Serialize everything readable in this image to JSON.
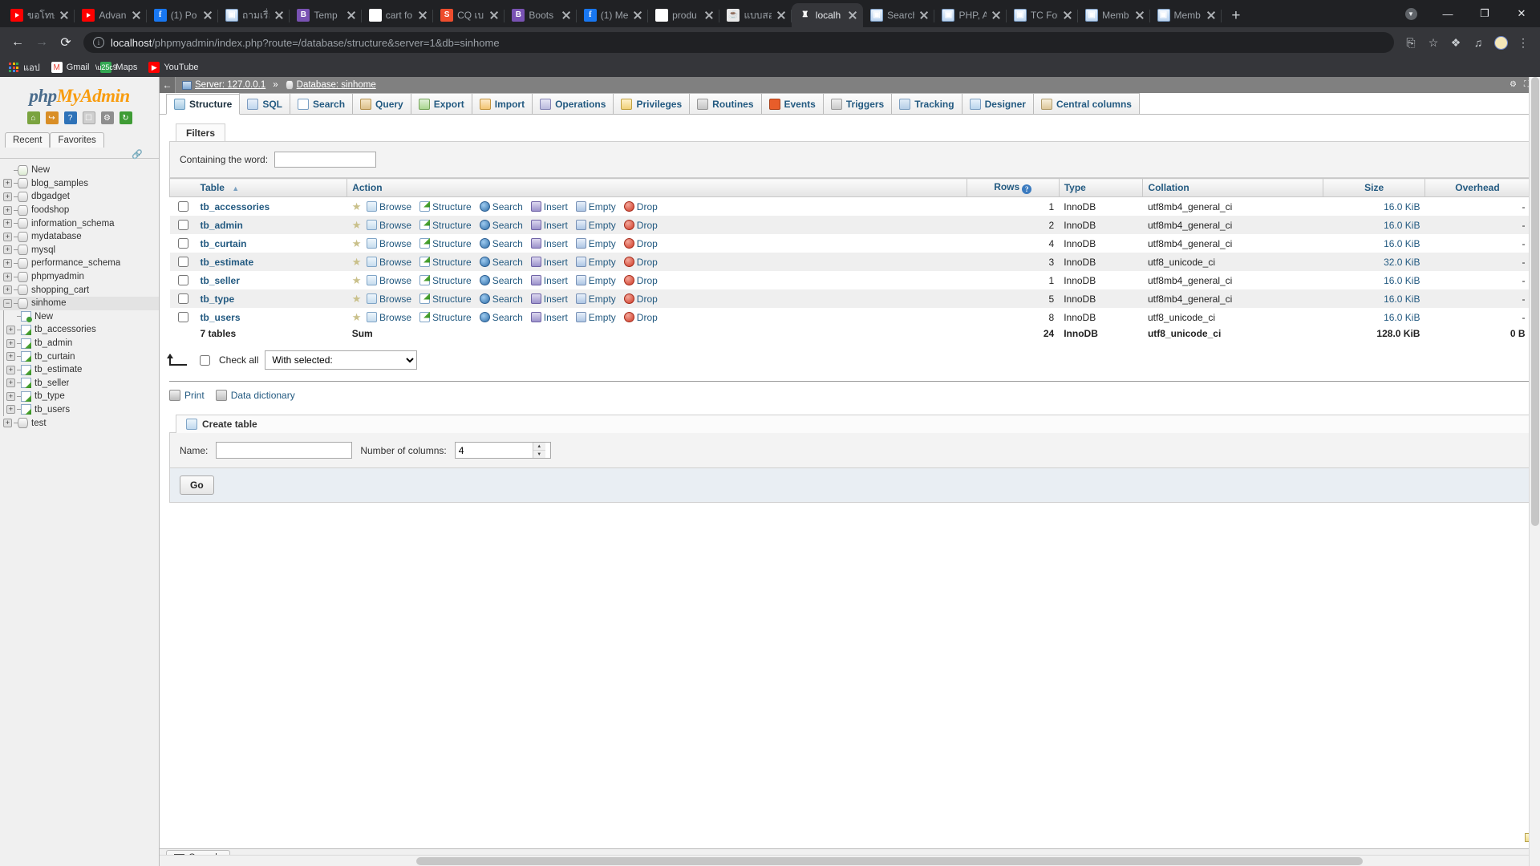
{
  "browser": {
    "tabs": [
      {
        "label": "ขอโทษ",
        "icon": "youtube-icon",
        "icon_class": "fv-yt",
        "glyph": "",
        "active": false
      },
      {
        "label": "Advan",
        "icon": "youtube-icon",
        "icon_class": "fv-yt",
        "glyph": "",
        "active": false
      },
      {
        "label": "(1) Po",
        "icon": "facebook-icon",
        "icon_class": "fv-fb",
        "glyph": "f",
        "active": false
      },
      {
        "label": "ถามเรื่อ",
        "icon": "windows-page-icon",
        "icon_class": "fv-ie",
        "glyph": "▣",
        "active": false
      },
      {
        "label": "Temp",
        "icon": "bootstrap-icon",
        "icon_class": "fv-b",
        "glyph": "B",
        "active": false
      },
      {
        "label": "cart fo",
        "icon": "google-icon",
        "icon_class": "fv-g",
        "glyph": "G",
        "active": false
      },
      {
        "label": "CQ เบ",
        "icon": "shopee-icon",
        "icon_class": "fv-s",
        "glyph": "S",
        "active": false
      },
      {
        "label": "Boots",
        "icon": "bootstrap-icon",
        "icon_class": "fv-b",
        "glyph": "B",
        "active": false
      },
      {
        "label": "(1) Me",
        "icon": "facebook-icon",
        "icon_class": "fv-fb",
        "glyph": "f",
        "active": false
      },
      {
        "label": "produ",
        "icon": "google-icon",
        "icon_class": "fv-g",
        "glyph": "G",
        "active": false
      },
      {
        "label": "แบบสอ",
        "icon": "java-icon",
        "icon_class": "fv-java",
        "glyph": "☕",
        "active": false
      },
      {
        "label": "localh",
        "icon": "phpmyadmin-icon",
        "icon_class": "fv-pma",
        "glyph": "♜",
        "active": true
      },
      {
        "label": "Search",
        "icon": "windows-page-icon",
        "icon_class": "fv-ie",
        "glyph": "▣",
        "active": false
      },
      {
        "label": "PHP, A",
        "icon": "windows-page-icon",
        "icon_class": "fv-ie",
        "glyph": "▣",
        "active": false
      },
      {
        "label": "TC For",
        "icon": "windows-page-icon",
        "icon_class": "fv-ie",
        "glyph": "▣",
        "active": false
      },
      {
        "label": "Memb",
        "icon": "windows-page-icon",
        "icon_class": "fv-ie",
        "glyph": "▣",
        "active": false
      },
      {
        "label": "Memb",
        "icon": "windows-page-icon",
        "icon_class": "fv-ie",
        "glyph": "▣",
        "active": false
      }
    ],
    "new_tab_label": "+",
    "window_controls": {
      "minimize": "—",
      "maximize": "❐",
      "close": "✕",
      "chevron": "▼"
    },
    "nav": {
      "back": "←",
      "forward": "→",
      "reload": "⟳"
    },
    "omnibox": {
      "host": "localhost",
      "path": "/phpmyadmin/index.php?route=/database/structure&server=1&db=sinhome",
      "info_glyph": "i"
    },
    "toolbar_icons": {
      "translate": "⎘",
      "star": "☆",
      "extensions": "❖",
      "media": "♫",
      "menu": "⋮"
    },
    "bookmarks": [
      {
        "label": "แอป",
        "icon": "apps-grid-icon"
      },
      {
        "label": "Gmail",
        "icon": "gmail-icon"
      },
      {
        "label": "Maps",
        "icon": "maps-icon"
      },
      {
        "label": "YouTube",
        "icon": "youtube-icon"
      }
    ]
  },
  "sidebar": {
    "logo": {
      "part1": "php",
      "part2": "MyAdmin"
    },
    "icons": [
      {
        "name": "home-icon",
        "glyph": "⌂"
      },
      {
        "name": "logout-icon",
        "glyph": "↪"
      },
      {
        "name": "help-docs-icon",
        "glyph": "?"
      },
      {
        "name": "documentation-icon",
        "glyph": "❐"
      },
      {
        "name": "settings-gear-icon",
        "glyph": "⚙"
      },
      {
        "name": "reload-navigation-icon",
        "glyph": "⟳"
      }
    ],
    "recent_label": "Recent",
    "favorites_label": "Favorites",
    "tree": [
      {
        "label": "New",
        "type": "new",
        "depth": 0,
        "expander": null
      },
      {
        "label": "blog_samples",
        "type": "db",
        "depth": 0,
        "expander": "+"
      },
      {
        "label": "dbgadget",
        "type": "db",
        "depth": 0,
        "expander": "+"
      },
      {
        "label": "foodshop",
        "type": "db",
        "depth": 0,
        "expander": "+"
      },
      {
        "label": "information_schema",
        "type": "db",
        "depth": 0,
        "expander": "+"
      },
      {
        "label": "mydatabase",
        "type": "db",
        "depth": 0,
        "expander": "+"
      },
      {
        "label": "mysql",
        "type": "db",
        "depth": 0,
        "expander": "+"
      },
      {
        "label": "performance_schema",
        "type": "db",
        "depth": 0,
        "expander": "+"
      },
      {
        "label": "phpmyadmin",
        "type": "db",
        "depth": 0,
        "expander": "+"
      },
      {
        "label": "shopping_cart",
        "type": "db",
        "depth": 0,
        "expander": "+"
      },
      {
        "label": "sinhome",
        "type": "db",
        "depth": 0,
        "expander": "−",
        "selected": true
      },
      {
        "label": "New",
        "type": "newtable",
        "depth": 1,
        "expander": null
      },
      {
        "label": "tb_accessories",
        "type": "table",
        "depth": 1,
        "expander": "+"
      },
      {
        "label": "tb_admin",
        "type": "table",
        "depth": 1,
        "expander": "+"
      },
      {
        "label": "tb_curtain",
        "type": "table",
        "depth": 1,
        "expander": "+"
      },
      {
        "label": "tb_estimate",
        "type": "table",
        "depth": 1,
        "expander": "+"
      },
      {
        "label": "tb_seller",
        "type": "table",
        "depth": 1,
        "expander": "+"
      },
      {
        "label": "tb_type",
        "type": "table",
        "depth": 1,
        "expander": "+"
      },
      {
        "label": "tb_users",
        "type": "table",
        "depth": 1,
        "expander": "+"
      },
      {
        "label": "test",
        "type": "db",
        "depth": 0,
        "expander": "+"
      }
    ]
  },
  "breadcrumb": {
    "back_glyph": "←",
    "server_label": "Server: 127.0.0.1",
    "separator": "»",
    "database_label": "Database: sinhome"
  },
  "main_tabs": [
    {
      "label": "Structure",
      "icon": "structure-icon",
      "icon_class": "pic-struct",
      "active": true
    },
    {
      "label": "SQL",
      "icon": "sql-icon",
      "icon_class": "pic-sql",
      "active": false
    },
    {
      "label": "Search",
      "icon": "search-icon",
      "icon_class": "pic-search",
      "active": false
    },
    {
      "label": "Query",
      "icon": "query-icon",
      "icon_class": "pic-query",
      "active": false
    },
    {
      "label": "Export",
      "icon": "export-icon",
      "icon_class": "pic-export",
      "active": false
    },
    {
      "label": "Import",
      "icon": "import-icon",
      "icon_class": "pic-import",
      "active": false
    },
    {
      "label": "Operations",
      "icon": "operations-icon",
      "icon_class": "pic-ops",
      "active": false
    },
    {
      "label": "Privileges",
      "icon": "privileges-icon",
      "icon_class": "pic-priv",
      "active": false
    },
    {
      "label": "Routines",
      "icon": "routines-icon",
      "icon_class": "pic-rout",
      "active": false
    },
    {
      "label": "Events",
      "icon": "events-icon",
      "icon_class": "pic-ev",
      "active": false
    },
    {
      "label": "Triggers",
      "icon": "triggers-icon",
      "icon_class": "pic-trig",
      "active": false
    },
    {
      "label": "Tracking",
      "icon": "tracking-icon",
      "icon_class": "pic-track",
      "active": false
    },
    {
      "label": "Designer",
      "icon": "designer-icon",
      "icon_class": "pic-design",
      "active": false
    },
    {
      "label": "Central columns",
      "icon": "central-columns-icon",
      "icon_class": "pic-central",
      "active": false
    }
  ],
  "filters": {
    "legend": "Filters",
    "containing_label": "Containing the word:",
    "containing_value": "",
    "containing_placeholder": ""
  },
  "table_list": {
    "columns": [
      "Table",
      "Action",
      "Rows",
      "Type",
      "Collation",
      "Size",
      "Overhead"
    ],
    "sort_indicator": "▲",
    "rows_help_glyph": "?",
    "actions": [
      "Browse",
      "Structure",
      "Search",
      "Insert",
      "Empty",
      "Drop"
    ],
    "action_icons": [
      "ai-browse",
      "ai-struct",
      "ai-search",
      "ai-insert",
      "ai-empty",
      "ai-drop"
    ],
    "rows": [
      {
        "name": "tb_accessories",
        "rows": "1",
        "type": "InnoDB",
        "collation": "utf8mb4_general_ci",
        "size": "16.0 KiB",
        "overhead": "-"
      },
      {
        "name": "tb_admin",
        "rows": "2",
        "type": "InnoDB",
        "collation": "utf8mb4_general_ci",
        "size": "16.0 KiB",
        "overhead": "-"
      },
      {
        "name": "tb_curtain",
        "rows": "4",
        "type": "InnoDB",
        "collation": "utf8mb4_general_ci",
        "size": "16.0 KiB",
        "overhead": "-"
      },
      {
        "name": "tb_estimate",
        "rows": "3",
        "type": "InnoDB",
        "collation": "utf8_unicode_ci",
        "size": "32.0 KiB",
        "overhead": "-"
      },
      {
        "name": "tb_seller",
        "rows": "1",
        "type": "InnoDB",
        "collation": "utf8mb4_general_ci",
        "size": "16.0 KiB",
        "overhead": "-"
      },
      {
        "name": "tb_type",
        "rows": "5",
        "type": "InnoDB",
        "collation": "utf8mb4_general_ci",
        "size": "16.0 KiB",
        "overhead": "-"
      },
      {
        "name": "tb_users",
        "rows": "8",
        "type": "InnoDB",
        "collation": "utf8_unicode_ci",
        "size": "16.0 KiB",
        "overhead": "-"
      }
    ],
    "summary": {
      "tables_count": "7 tables",
      "sum_label": "Sum",
      "rows": "24",
      "type": "InnoDB",
      "collation": "utf8_unicode_ci",
      "size": "128.0 KiB",
      "overhead": "0 B"
    }
  },
  "bulk": {
    "check_all_label": "Check all",
    "with_selected_label": "With selected:",
    "options": [
      "With selected:"
    ]
  },
  "footer_links": [
    {
      "label": "Print",
      "icon": "print-icon",
      "icon_class": "pic-print"
    },
    {
      "label": "Data dictionary",
      "icon": "data-dictionary-icon",
      "icon_class": "pic-dict"
    }
  ],
  "create_table": {
    "legend": "Create table",
    "name_label": "Name:",
    "name_value": "",
    "columns_label": "Number of columns:",
    "columns_value": "4",
    "go_label": "Go"
  },
  "console": {
    "label": "Console",
    "icon": "console-icon"
  },
  "colors": {
    "accent_blue": "#235a81",
    "pma_orange": "#f89c0e",
    "header_gray": "#808080",
    "row_even": "#efefef"
  }
}
